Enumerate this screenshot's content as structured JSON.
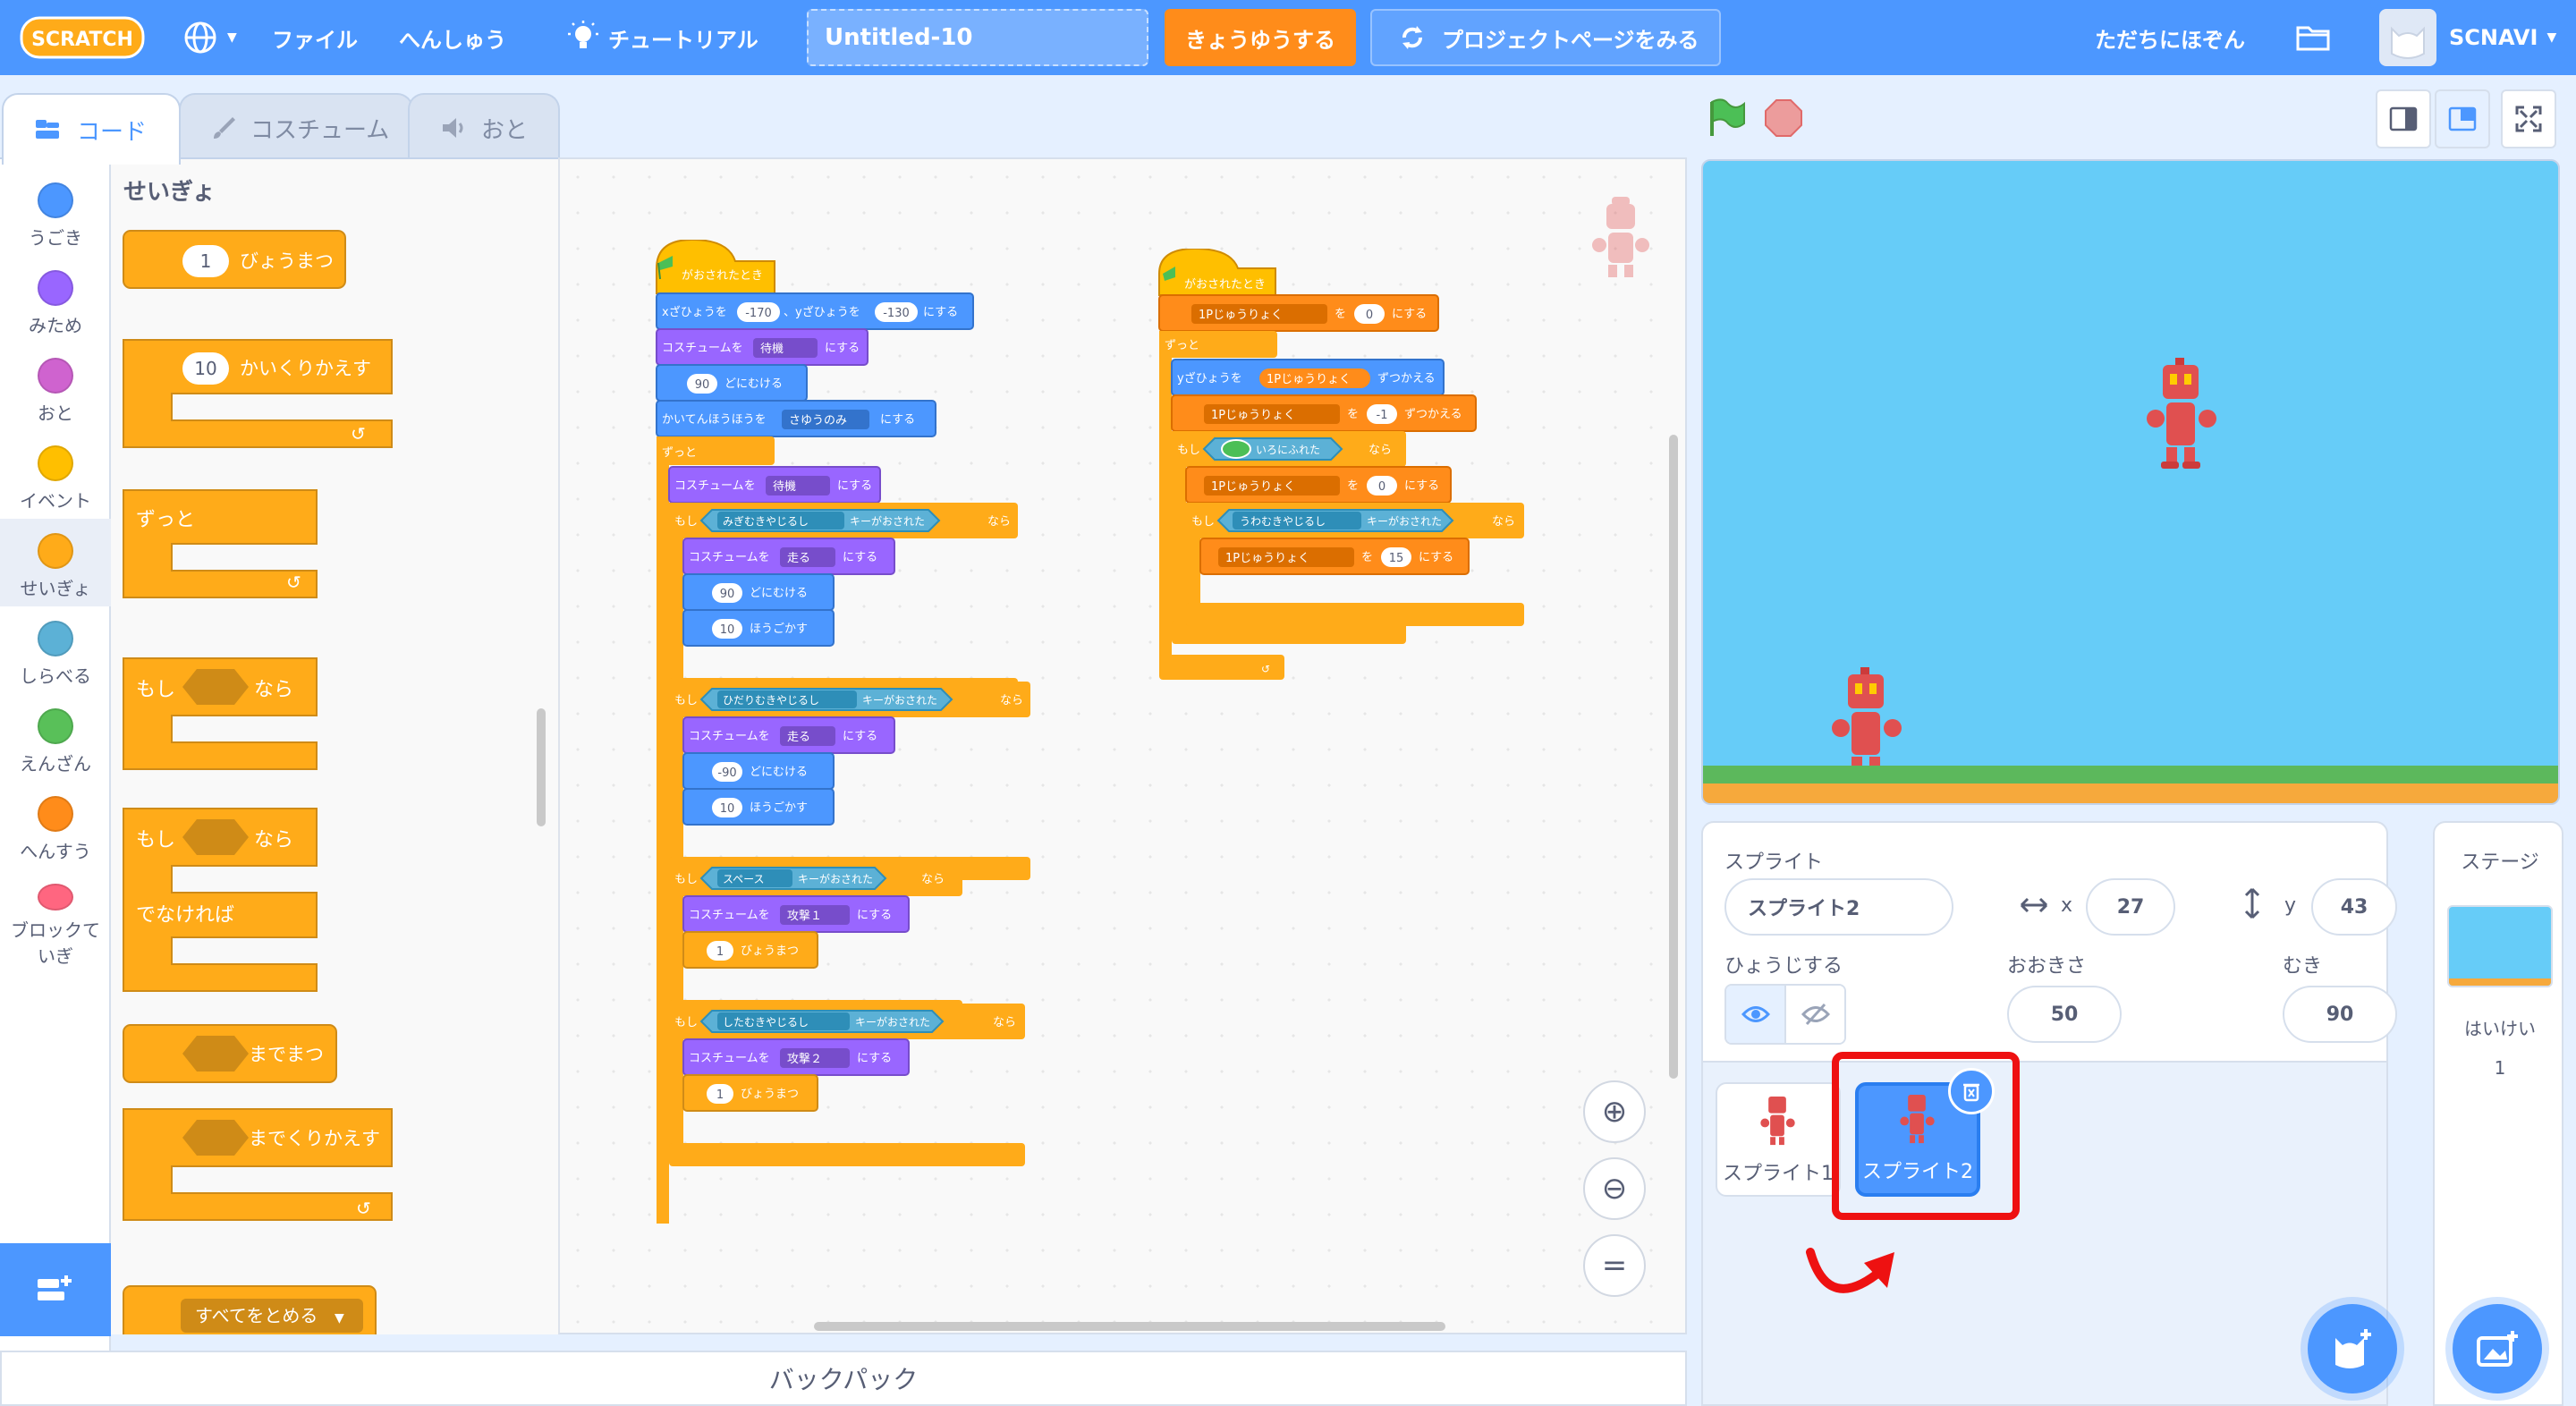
{
  "menubar": {
    "logo_text": "SCRATCH",
    "file": "ファイル",
    "edit": "へんしゅう",
    "tutorial": "チュートリアル",
    "project_title": "Untitled-10",
    "share": "きょうゆうする",
    "project_page": "プロジェクトページをみる",
    "save_now": "ただちにほぞん",
    "username": "SCNAVI"
  },
  "tabs": {
    "code": "コード",
    "costumes": "コスチューム",
    "sounds": "おと"
  },
  "categories": [
    {
      "label": "うごき",
      "color": "#4c97ff"
    },
    {
      "label": "みため",
      "color": "#9966ff"
    },
    {
      "label": "おと",
      "color": "#cf63cf"
    },
    {
      "label": "イベント",
      "color": "#ffbf00"
    },
    {
      "label": "せいぎょ",
      "color": "#ffab19"
    },
    {
      "label": "しらべる",
      "color": "#5cb1d6"
    },
    {
      "label": "えんざん",
      "color": "#59c059"
    },
    {
      "label": "へんすう",
      "color": "#ff8c1a"
    },
    {
      "label": "ブロックて",
      "label2": "いぎ",
      "color": "#ff6680"
    }
  ],
  "palette": {
    "title": "せいぎょ",
    "wait_num": "1",
    "wait_label": "びょうまつ",
    "repeat_num": "10",
    "repeat_label": "かいくりかえす",
    "forever": "ずっと",
    "if": "もし",
    "then": "なら",
    "else": "でなければ",
    "wait_until": "までまつ",
    "repeat_until": "までくりかえす",
    "stop_all": "すべてをとめる"
  },
  "script1": {
    "hat": "がおされたとき",
    "goto": [
      "xざひょうを",
      "-170",
      "、yざひょうを",
      "-130",
      "にする"
    ],
    "costume1": [
      "コスチュームを",
      "待機",
      "にする"
    ],
    "dir1": [
      "90",
      "どにむける"
    ],
    "rotation": [
      "かいてんほうほうを",
      "さゆうのみ",
      "にする"
    ],
    "forever": "ずっと",
    "costume2": [
      "コスチュームを",
      "待機",
      "にする"
    ],
    "if_right": [
      "もし",
      "みぎむきやじるし",
      "キーがおされた",
      "なら"
    ],
    "costume_run1": [
      "コスチュームを",
      "走る",
      "にする"
    ],
    "dir2": [
      "90",
      "どにむける"
    ],
    "move1": [
      "10",
      "ほうごかす"
    ],
    "if_left": [
      "もし",
      "ひだりむきやじるし",
      "キーがおされた",
      "なら"
    ],
    "costume_run2": [
      "コスチュームを",
      "走る",
      "にする"
    ],
    "dir3": [
      "-90",
      "どにむける"
    ],
    "move2": [
      "10",
      "ほうごかす"
    ],
    "if_space": [
      "もし",
      "スペース",
      "キーがおされた",
      "なら"
    ],
    "costume_atk1": [
      "コスチュームを",
      "攻撃１",
      "にする"
    ],
    "wait1": [
      "1",
      "びょうまつ"
    ],
    "if_down": [
      "もし",
      "したむきやじるし",
      "キーがおされた",
      "なら"
    ],
    "costume_atk2": [
      "コスチュームを",
      "攻撃２",
      "にする"
    ],
    "wait2": [
      "1",
      "びょうまつ"
    ]
  },
  "script2": {
    "hat": "がおされたとき",
    "set_var": [
      "1Pじゅうりょく",
      "を",
      "0",
      "にする"
    ],
    "forever": "ずっと",
    "change_y": [
      "yざひょうを",
      "1Pじゅうりょく",
      "ずつかえる"
    ],
    "change_var": [
      "1Pじゅうりょく",
      "を",
      "-1",
      "ずつかえる"
    ],
    "if_touch": [
      "もし",
      "いろにふれた",
      "なら"
    ],
    "set_var2": [
      "1Pじゅうりょく",
      "を",
      "0",
      "にする"
    ],
    "if_up": [
      "もし",
      "うわむきやじるし",
      "キーがおされた",
      "なら"
    ],
    "set_var3": [
      "1Pじゅうりょく",
      "を",
      "15",
      "にする"
    ]
  },
  "backpack": "バックパック",
  "sprite_info": {
    "sprite_label": "スプライト",
    "sprite_name": "スプライト2",
    "x_label": "x",
    "x_value": "27",
    "y_label": "y",
    "y_value": "43",
    "show_label": "ひょうじする",
    "size_label": "おおきさ",
    "size_value": "50",
    "direction_label": "むき",
    "direction_value": "90"
  },
  "sprites": [
    {
      "name": "スプライト1",
      "selected": false
    },
    {
      "name": "スプライト2",
      "selected": true
    }
  ],
  "stage_pane": {
    "title": "ステージ",
    "backdrop_label": "はいけい",
    "backdrop_count": "1"
  },
  "colors": {
    "accent": "#4c97ff",
    "highlight": "#ee1111",
    "motion": "#4c97ff",
    "looks": "#9966ff",
    "control": "#ffab19",
    "events": "#ffbf00",
    "sensing": "#5cb1d6",
    "variables": "#ff8c1a"
  }
}
